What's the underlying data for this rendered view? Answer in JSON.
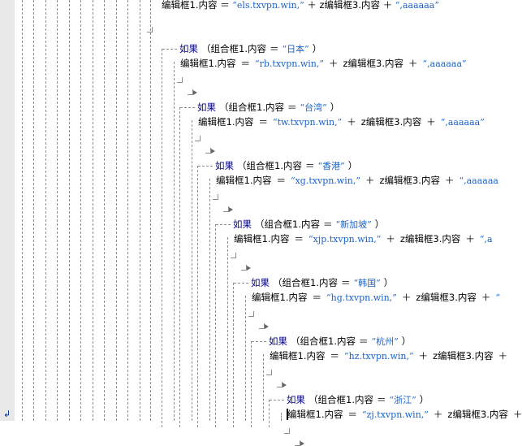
{
  "editor": {
    "top_line": {
      "target": "编辑框1.内容",
      "eq": "＝",
      "str1": "“els.txvpn.win,”",
      "plus": "＋",
      "mid": "z编辑框3.内容",
      "str2": "“,aaaaaa”"
    },
    "blocks": [
      {
        "if_kw": "如果",
        "cond_open": "（组合框1.内容",
        "eq": "＝",
        "value": "“日本”",
        "cond_close": "）",
        "target": "编辑框1.内容",
        "str1": "“rb.txvpn.win,”",
        "plus": "＋",
        "mid": "z编辑框3.内容",
        "str2": "“,aaaaaa”"
      },
      {
        "if_kw": "如果",
        "cond_open": "（组合框1.内容",
        "eq": "＝",
        "value": "“台湾”",
        "cond_close": "）",
        "target": "编辑框1.内容",
        "str1": "“tw.txvpn.win,”",
        "plus": "＋",
        "mid": "z编辑框3.内容",
        "str2": "“,aaaaaa”"
      },
      {
        "if_kw": "如果",
        "cond_open": "（组合框1.内容",
        "eq": "＝",
        "value": "“香港”",
        "cond_close": "）",
        "target": "编辑框1.内容",
        "str1": "“xg.txvpn.win,”",
        "plus": "＋",
        "mid": "z编辑框3.内容",
        "str2": "“,aaaaaa"
      },
      {
        "if_kw": "如果",
        "cond_open": "（组合框1.内容",
        "eq": "＝",
        "value": "“新加坡”",
        "cond_close": "）",
        "target": "编辑框1.内容",
        "str1": "“xjp.txvpn.win,”",
        "plus": "＋",
        "mid": "z编辑框3.内容",
        "str2": "“,a"
      },
      {
        "if_kw": "如果",
        "cond_open": "（组合框1.内容",
        "eq": "＝",
        "value": "“韩国”",
        "cond_close": "）",
        "target": "编辑框1.内容",
        "str1": "“hg.txvpn.win,”",
        "plus": "＋",
        "mid": "z编辑框3.内容",
        "str2": "“"
      },
      {
        "if_kw": "如果",
        "cond_open": "（组合框1.内容",
        "eq": "＝",
        "value": "“杭州”",
        "cond_close": "）",
        "target": "编辑框1.内容",
        "str1": "“hz.txvpn.win,”",
        "plus": "＋",
        "mid": "z编辑框3.内容",
        "str2": ""
      },
      {
        "if_kw": "如果",
        "cond_open": "（组合框1.内容",
        "eq": "＝",
        "value": "“浙江”",
        "cond_close": "）",
        "target": "编辑框1.内容",
        "str1": "“zj.txvpn.win,”",
        "plus": "＋",
        "mid": "z编辑框3.内容",
        "str2": ""
      }
    ]
  },
  "gutter": {
    "marker_icon": "down-left-arrow-icon",
    "marker_glyph": "↲"
  }
}
